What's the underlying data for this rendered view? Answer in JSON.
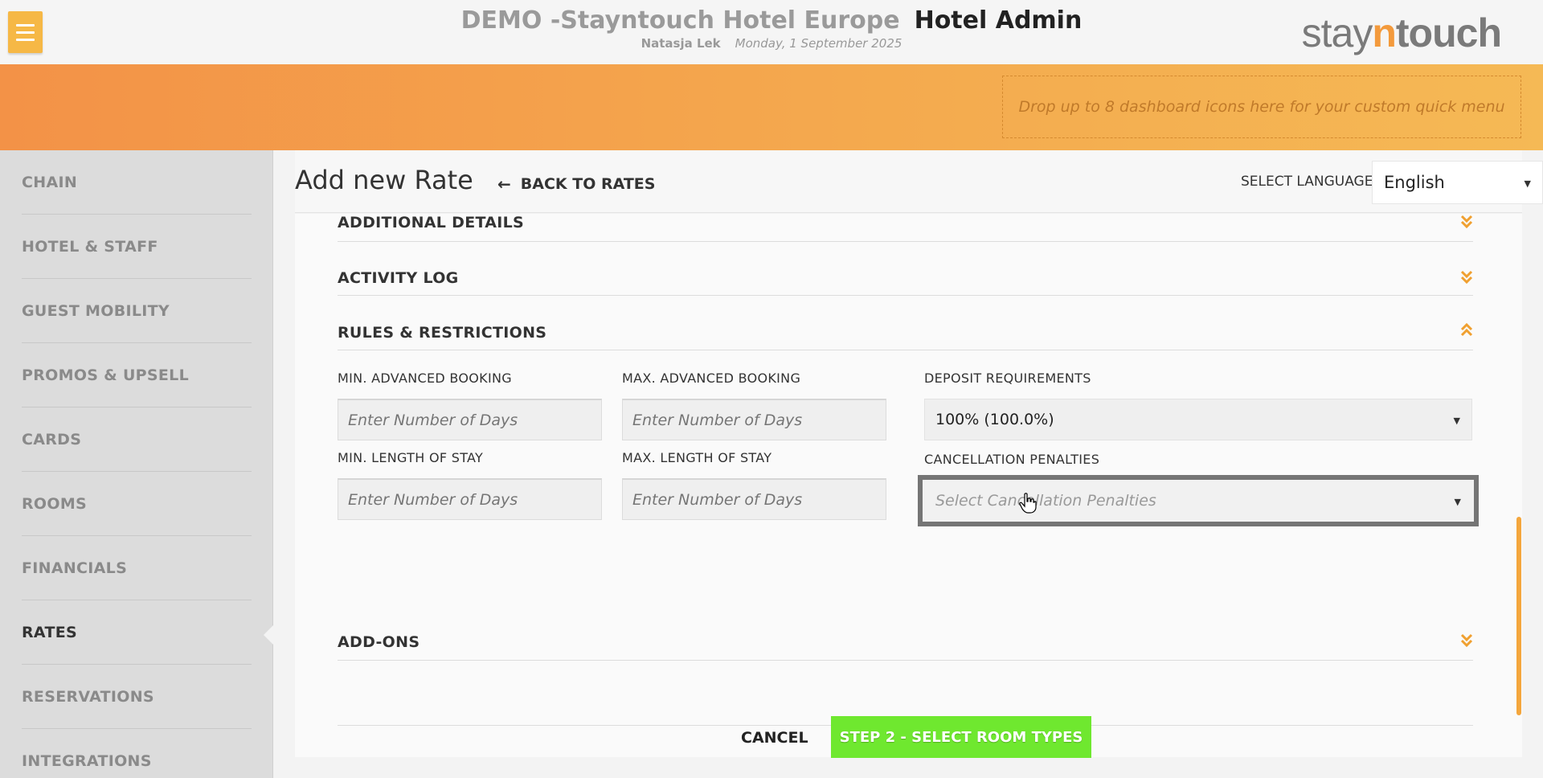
{
  "header": {
    "hotel_name": "DEMO -Stayntouch Hotel Europe",
    "app_name": "Hotel Admin",
    "user": "Natasja Lek",
    "date": "Monday, 1 September 2025",
    "logo": {
      "part1": "stay",
      "part2": "n",
      "part3": "touch"
    }
  },
  "quick_menu": {
    "placeholder": "Drop up to 8 dashboard icons here for your custom quick menu"
  },
  "sidebar": {
    "items": [
      {
        "label": "CHAIN"
      },
      {
        "label": "HOTEL & STAFF"
      },
      {
        "label": "GUEST MOBILITY"
      },
      {
        "label": "PROMOS & UPSELL"
      },
      {
        "label": "CARDS"
      },
      {
        "label": "ROOMS"
      },
      {
        "label": "FINANCIALS"
      },
      {
        "label": "RATES",
        "active": true
      },
      {
        "label": "RESERVATIONS"
      },
      {
        "label": "INTEGRATIONS"
      }
    ]
  },
  "page": {
    "title": "Add new Rate",
    "back_label": "BACK TO RATES",
    "language_label": "SELECT LANGUAGE",
    "language_value": "English"
  },
  "sections": {
    "additional_details": "ADDITIONAL DETAILS",
    "activity_log": "ACTIVITY LOG",
    "rules": "RULES & RESTRICTIONS",
    "addons": "ADD-ONS"
  },
  "rules": {
    "min_adv_label": "MIN. ADVANCED BOOKING",
    "max_adv_label": "MAX. ADVANCED BOOKING",
    "min_los_label": "MIN. LENGTH OF STAY",
    "max_los_label": "MAX. LENGTH OF STAY",
    "days_placeholder": "Enter Number of Days",
    "deposit_label": "DEPOSIT REQUIREMENTS",
    "deposit_value": "100% (100.0%)",
    "cancel_label": "CANCELLATION PENALTIES",
    "cancel_placeholder": "Select Cancellation Penalties"
  },
  "actions": {
    "cancel": "CANCEL",
    "next": "STEP 2 - SELECT ROOM TYPES"
  },
  "colors": {
    "accent": "#f39a3c",
    "primary_button": "#6fe82f"
  }
}
